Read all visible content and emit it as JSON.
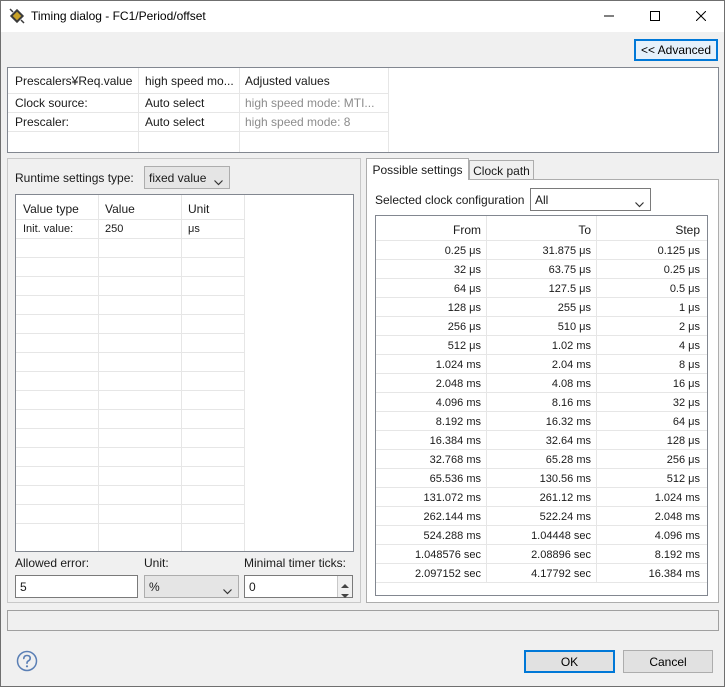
{
  "window": {
    "title": "Timing dialog - FC1/Period/offset",
    "controls": {
      "minimize_icon": "minimize-icon",
      "maximize_icon": "maximize-icon",
      "close_icon": "close-icon"
    }
  },
  "advanced_button": "<< Advanced",
  "prescaler_table": {
    "headers": [
      "Prescalers¥Req.value",
      "high speed mo...",
      "Adjusted values"
    ],
    "rows": [
      {
        "label": "Clock source:",
        "value": "Auto select",
        "adjusted": "high speed mode: MTI..."
      },
      {
        "label": "Prescaler:",
        "value": "Auto select",
        "adjusted": "high speed mode: 8"
      }
    ]
  },
  "runtime": {
    "label": "Runtime settings type:",
    "selected": "fixed value",
    "table": {
      "headers": [
        "Value type",
        "Value",
        "Unit"
      ],
      "rows": [
        {
          "type": "Init. value:",
          "value": "250",
          "unit": "μs"
        }
      ]
    },
    "allowed_error": {
      "label": "Allowed error:",
      "value": "5"
    },
    "unit": {
      "label": "Unit:",
      "value": "%"
    },
    "min_ticks": {
      "label": "Minimal timer ticks:",
      "value": "0"
    }
  },
  "tabs": [
    {
      "label": "Possible settings",
      "active": true
    },
    {
      "label": "Clock path",
      "active": false
    }
  ],
  "possible": {
    "config_label": "Selected clock configuration",
    "config_selected": "All",
    "headers": [
      "From",
      "To",
      "Step"
    ],
    "rows": [
      [
        "0.25 μs",
        "31.875 μs",
        "0.125 μs"
      ],
      [
        "32 μs",
        "63.75 μs",
        "0.25 μs"
      ],
      [
        "64 μs",
        "127.5 μs",
        "0.5 μs"
      ],
      [
        "128 μs",
        "255 μs",
        "1 μs"
      ],
      [
        "256 μs",
        "510 μs",
        "2 μs"
      ],
      [
        "512 μs",
        "1.02 ms",
        "4 μs"
      ],
      [
        "1.024 ms",
        "2.04 ms",
        "8 μs"
      ],
      [
        "2.048 ms",
        "4.08 ms",
        "16 μs"
      ],
      [
        "4.096 ms",
        "8.16 ms",
        "32 μs"
      ],
      [
        "8.192 ms",
        "16.32 ms",
        "64 μs"
      ],
      [
        "16.384 ms",
        "32.64 ms",
        "128 μs"
      ],
      [
        "32.768 ms",
        "65.28 ms",
        "256 μs"
      ],
      [
        "65.536 ms",
        "130.56 ms",
        "512 μs"
      ],
      [
        "131.072 ms",
        "261.12 ms",
        "1.024 ms"
      ],
      [
        "262.144 ms",
        "522.24 ms",
        "2.048 ms"
      ],
      [
        "524.288 ms",
        "1.04448 sec",
        "4.096 ms"
      ],
      [
        "1.048576 sec",
        "2.08896 sec",
        "8.192 ms"
      ],
      [
        "2.097152 sec",
        "4.17792 sec",
        "16.384 ms"
      ]
    ]
  },
  "footer": {
    "help_icon": "help-icon",
    "ok": "OK",
    "cancel": "Cancel"
  },
  "colors": {
    "accent": "#0078d7",
    "border": "#a0a0a0",
    "background": "#f0f0f0"
  }
}
